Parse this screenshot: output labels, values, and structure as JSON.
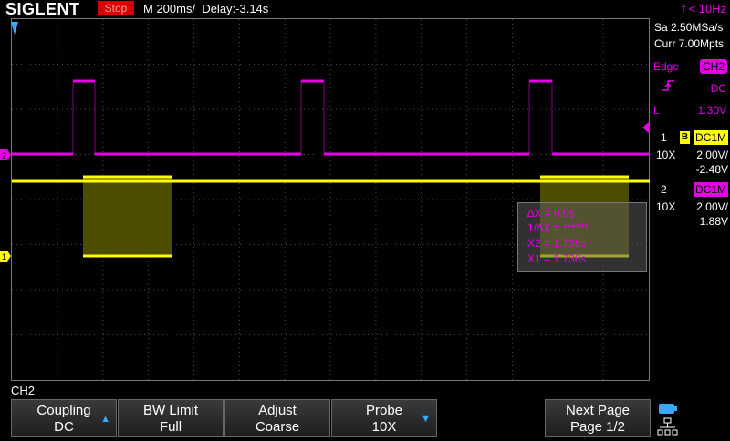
{
  "header": {
    "brand": "SIGLENT",
    "status": "Stop",
    "timebase": "M 200ms/",
    "delay": "Delay:-3.14s",
    "trigger_frequency": "f < 10Hz"
  },
  "acquisition": {
    "sample_rate": "Sa 2.50MSa/s",
    "memory_depth": "Curr 7.00Mpts"
  },
  "trigger": {
    "type": "Edge",
    "source": "CH2",
    "coupling": "DC",
    "level_label": "L",
    "level": "1.30V"
  },
  "channels": [
    {
      "num": "1",
      "bw_badge": "B",
      "coupling": "DC1M",
      "probe": "10X",
      "scale": "2.00V/",
      "offset": "-2.48V",
      "color": "#ffff00"
    },
    {
      "num": "2",
      "coupling": "DC1M",
      "probe": "10X",
      "scale": "2.00V/",
      "offset": "1.88V",
      "color": "#e600e6"
    }
  ],
  "markers": {
    "ch1": "1",
    "ch2": "2"
  },
  "cursors": {
    "dx": "∆X = 0.0s",
    "inv_dx": "1/∆X = ******",
    "x2": "X2 = 1.736s",
    "x1": "X1 = 1.736s"
  },
  "menu": {
    "title": "CH2",
    "softkeys": [
      {
        "label": "Coupling",
        "value": "DC",
        "arrow": "▲"
      },
      {
        "label": "BW Limit",
        "value": "Full",
        "arrow": ""
      },
      {
        "label": "Adjust",
        "value": "Coarse",
        "arrow": ""
      },
      {
        "label": "Probe",
        "value": "10X",
        "arrow": "▼"
      },
      {
        "label": "Next Page",
        "value": "Page 1/2",
        "arrow": ""
      }
    ]
  },
  "colors": {
    "ch1": "#ffff00",
    "ch2": "#e600e6",
    "stop_badge": "#d80000",
    "accent": "#39a8ff"
  }
}
